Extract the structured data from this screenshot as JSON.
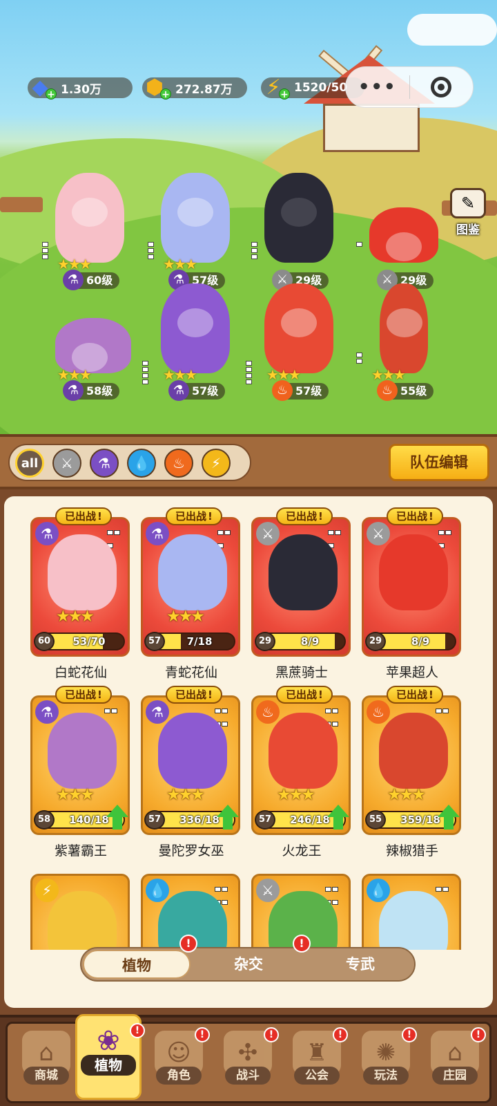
{
  "resources": {
    "gems": "1.30万",
    "gold": "272.87万",
    "energy": "1520/50"
  },
  "capsule": {
    "more_glyph": "•••"
  },
  "gallery_label": "图鉴",
  "team_heroes": [
    {
      "level": "60级",
      "element": "poison",
      "stars": "★★★"
    },
    {
      "level": "57级",
      "element": "poison",
      "stars": "★★★"
    },
    {
      "level": "29级",
      "element": "sword",
      "stars": ""
    },
    {
      "level": "29级",
      "element": "sword",
      "stars": ""
    },
    {
      "level": "58级",
      "element": "poison",
      "stars": "★★★"
    },
    {
      "level": "57级",
      "element": "poison",
      "stars": "★★★"
    },
    {
      "level": "57级",
      "element": "fire",
      "stars": "★★★"
    },
    {
      "level": "55级",
      "element": "fire",
      "stars": "★★★"
    }
  ],
  "filters": {
    "all_label": "all",
    "team_edit_label": "队伍编辑"
  },
  "cards": [
    {
      "name": "白蛇花仙",
      "badge": "已出战",
      "level": "60",
      "progress": "53/70",
      "fill": 0.757,
      "theme": "red",
      "element": "poison",
      "upgrade": false
    },
    {
      "name": "青蛇花仙",
      "badge": "已出战",
      "level": "57",
      "progress": "7/18",
      "fill": 0.389,
      "theme": "red",
      "element": "poison",
      "upgrade": false
    },
    {
      "name": "黑蔗骑士",
      "badge": "已出战",
      "level": "29",
      "progress": "8/9",
      "fill": 0.889,
      "theme": "red",
      "element": "sword",
      "upgrade": false
    },
    {
      "name": "苹果超人",
      "badge": "已出战",
      "level": "29",
      "progress": "8/9",
      "fill": 0.889,
      "theme": "red",
      "element": "sword",
      "upgrade": false
    },
    {
      "name": "紫薯霸王",
      "badge": "已出战",
      "level": "58",
      "progress": "140/18",
      "fill": 1,
      "theme": "gold",
      "element": "poison",
      "upgrade": true
    },
    {
      "name": "曼陀罗女巫",
      "badge": "已出战",
      "level": "57",
      "progress": "336/18",
      "fill": 1,
      "theme": "gold",
      "element": "poison",
      "upgrade": true
    },
    {
      "name": "火龙王",
      "badge": "已出战",
      "level": "57",
      "progress": "246/18",
      "fill": 1,
      "theme": "gold",
      "element": "fire",
      "upgrade": true
    },
    {
      "name": "辣椒猎手",
      "badge": "已出战",
      "level": "55",
      "progress": "359/18",
      "fill": 1,
      "theme": "gold",
      "element": "fire",
      "upgrade": true
    }
  ],
  "segments": [
    "植物",
    "杂交",
    "专武"
  ],
  "nav": [
    "商城",
    "植物",
    "角色",
    "战斗",
    "公会",
    "玩法",
    "庄园"
  ],
  "alert_glyph": "!"
}
